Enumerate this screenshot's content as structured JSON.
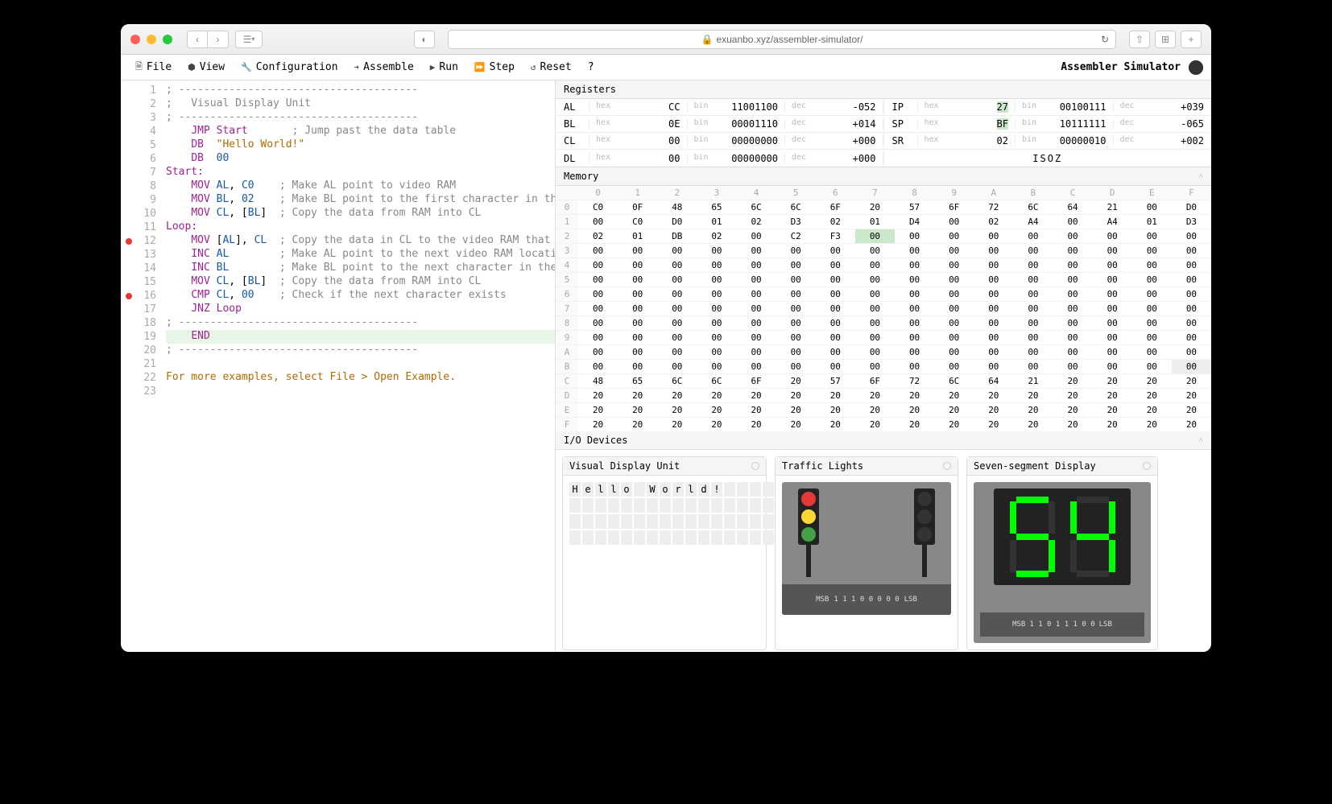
{
  "browser": {
    "url": "exuanbo.xyz/assembler-simulator/"
  },
  "toolbar": {
    "file": "File",
    "view": "View",
    "configuration": "Configuration",
    "assemble": "Assemble",
    "run": "Run",
    "step": "Step",
    "reset": "Reset",
    "help": "?",
    "title": "Assembler Simulator"
  },
  "editor": {
    "lines": [
      {
        "n": 1,
        "bp": false,
        "html": "<span class='c-comment'>; --------------------------------------</span>"
      },
      {
        "n": 2,
        "bp": false,
        "html": "<span class='c-comment'>;   Visual Display Unit</span>"
      },
      {
        "n": 3,
        "bp": false,
        "html": "<span class='c-comment'>; --------------------------------------</span>"
      },
      {
        "n": 4,
        "bp": false,
        "html": "    <span class='c-kw'>JMP</span> <span class='c-ident'>Start</span>       <span class='c-comment'>; Jump past the data table</span>"
      },
      {
        "n": 5,
        "bp": false,
        "html": "    <span class='c-kw'>DB</span>  <span class='c-str'>\"Hello World!\"</span>"
      },
      {
        "n": 6,
        "bp": false,
        "html": "    <span class='c-kw'>DB</span>  <span class='c-num'>00</span>"
      },
      {
        "n": 7,
        "bp": false,
        "html": "<span class='c-label'>Start:</span>"
      },
      {
        "n": 8,
        "bp": false,
        "html": "    <span class='c-kw'>MOV</span> <span class='c-reg'>AL</span>, <span class='c-num'>C0</span>    <span class='c-comment'>; Make AL point to video RAM</span>"
      },
      {
        "n": 9,
        "bp": false,
        "html": "    <span class='c-kw'>MOV</span> <span class='c-reg'>BL</span>, <span class='c-num'>02</span>    <span class='c-comment'>; Make BL point to the first character in the strin</span>"
      },
      {
        "n": 10,
        "bp": false,
        "html": "    <span class='c-kw'>MOV</span> <span class='c-reg'>CL</span>, [<span class='c-reg'>BL</span>]  <span class='c-comment'>; Copy the data from RAM into CL</span>"
      },
      {
        "n": 11,
        "bp": false,
        "html": "<span class='c-label'>Loop:</span>"
      },
      {
        "n": 12,
        "bp": true,
        "html": "    <span class='c-kw'>MOV</span> [<span class='c-reg'>AL</span>], <span class='c-reg'>CL</span>  <span class='c-comment'>; Copy the data in CL to the video RAM that AL poin</span>"
      },
      {
        "n": 13,
        "bp": false,
        "html": "    <span class='c-kw'>INC</span> <span class='c-reg'>AL</span>        <span class='c-comment'>; Make AL point to the next video RAM location</span>"
      },
      {
        "n": 14,
        "bp": false,
        "html": "    <span class='c-kw'>INC</span> <span class='c-reg'>BL</span>        <span class='c-comment'>; Make BL point to the next character in the string</span>"
      },
      {
        "n": 15,
        "bp": false,
        "html": "    <span class='c-kw'>MOV</span> <span class='c-reg'>CL</span>, [<span class='c-reg'>BL</span>]  <span class='c-comment'>; Copy the data from RAM into CL</span>"
      },
      {
        "n": 16,
        "bp": true,
        "html": "    <span class='c-kw'>CMP</span> <span class='c-reg'>CL</span>, <span class='c-num'>00</span>    <span class='c-comment'>; Check if the next character exists</span>"
      },
      {
        "n": 17,
        "bp": false,
        "html": "    <span class='c-kw'>JNZ</span> <span class='c-ident'>Loop</span>"
      },
      {
        "n": 18,
        "bp": false,
        "html": "<span class='c-comment'>; --------------------------------------</span>"
      },
      {
        "n": 19,
        "bp": false,
        "hl": true,
        "html": "    <span class='c-kw'>END</span>"
      },
      {
        "n": 20,
        "bp": false,
        "html": "<span class='c-comment'>; --------------------------------------</span>"
      },
      {
        "n": 21,
        "bp": false,
        "html": ""
      },
      {
        "n": 22,
        "bp": false,
        "html": "<span class='c-str'>For more examples, select File > Open Example.</span>"
      },
      {
        "n": 23,
        "bp": false,
        "html": ""
      }
    ]
  },
  "registers": {
    "header": "Registers",
    "left": [
      {
        "name": "AL",
        "hex": "CC",
        "bin": "11001100",
        "dec": "-052"
      },
      {
        "name": "BL",
        "hex": "0E",
        "bin": "00001110",
        "dec": "+014"
      },
      {
        "name": "CL",
        "hex": "00",
        "bin": "00000000",
        "dec": "+000"
      },
      {
        "name": "DL",
        "hex": "00",
        "bin": "00000000",
        "dec": "+000"
      }
    ],
    "right": [
      {
        "name": "IP",
        "hex": "27",
        "bin": "00100111",
        "dec": "+039",
        "hl": true
      },
      {
        "name": "SP",
        "hex": "BF",
        "bin": "10111111",
        "dec": "-065",
        "hl": true
      },
      {
        "name": "SR",
        "hex": "02",
        "bin": "00000010",
        "dec": "+002"
      }
    ],
    "flags": "ISOZ"
  },
  "memory": {
    "header": "Memory",
    "cols": [
      "0",
      "1",
      "2",
      "3",
      "4",
      "5",
      "6",
      "7",
      "8",
      "9",
      "A",
      "B",
      "C",
      "D",
      "E",
      "F"
    ],
    "rows": [
      {
        "h": "0",
        "cells": [
          "C0",
          "0F",
          "48",
          "65",
          "6C",
          "6C",
          "6F",
          "20",
          "57",
          "6F",
          "72",
          "6C",
          "64",
          "21",
          "00",
          "D0"
        ]
      },
      {
        "h": "1",
        "cells": [
          "00",
          "C0",
          "D0",
          "01",
          "02",
          "D3",
          "02",
          "01",
          "D4",
          "00",
          "02",
          "A4",
          "00",
          "A4",
          "01",
          "D3"
        ]
      },
      {
        "h": "2",
        "cells": [
          "02",
          "01",
          "DB",
          "02",
          "00",
          "C2",
          "F3",
          "00",
          "00",
          "00",
          "00",
          "00",
          "00",
          "00",
          "00",
          "00"
        ],
        "hl": {
          "7": "ip"
        }
      },
      {
        "h": "3",
        "cells": [
          "00",
          "00",
          "00",
          "00",
          "00",
          "00",
          "00",
          "00",
          "00",
          "00",
          "00",
          "00",
          "00",
          "00",
          "00",
          "00"
        ]
      },
      {
        "h": "4",
        "cells": [
          "00",
          "00",
          "00",
          "00",
          "00",
          "00",
          "00",
          "00",
          "00",
          "00",
          "00",
          "00",
          "00",
          "00",
          "00",
          "00"
        ]
      },
      {
        "h": "5",
        "cells": [
          "00",
          "00",
          "00",
          "00",
          "00",
          "00",
          "00",
          "00",
          "00",
          "00",
          "00",
          "00",
          "00",
          "00",
          "00",
          "00"
        ]
      },
      {
        "h": "6",
        "cells": [
          "00",
          "00",
          "00",
          "00",
          "00",
          "00",
          "00",
          "00",
          "00",
          "00",
          "00",
          "00",
          "00",
          "00",
          "00",
          "00"
        ]
      },
      {
        "h": "7",
        "cells": [
          "00",
          "00",
          "00",
          "00",
          "00",
          "00",
          "00",
          "00",
          "00",
          "00",
          "00",
          "00",
          "00",
          "00",
          "00",
          "00"
        ]
      },
      {
        "h": "8",
        "cells": [
          "00",
          "00",
          "00",
          "00",
          "00",
          "00",
          "00",
          "00",
          "00",
          "00",
          "00",
          "00",
          "00",
          "00",
          "00",
          "00"
        ]
      },
      {
        "h": "9",
        "cells": [
          "00",
          "00",
          "00",
          "00",
          "00",
          "00",
          "00",
          "00",
          "00",
          "00",
          "00",
          "00",
          "00",
          "00",
          "00",
          "00"
        ]
      },
      {
        "h": "A",
        "cells": [
          "00",
          "00",
          "00",
          "00",
          "00",
          "00",
          "00",
          "00",
          "00",
          "00",
          "00",
          "00",
          "00",
          "00",
          "00",
          "00"
        ]
      },
      {
        "h": "B",
        "cells": [
          "00",
          "00",
          "00",
          "00",
          "00",
          "00",
          "00",
          "00",
          "00",
          "00",
          "00",
          "00",
          "00",
          "00",
          "00",
          "00"
        ],
        "hl": {
          "15": "sp"
        }
      },
      {
        "h": "C",
        "cells": [
          "48",
          "65",
          "6C",
          "6C",
          "6F",
          "20",
          "57",
          "6F",
          "72",
          "6C",
          "64",
          "21",
          "20",
          "20",
          "20",
          "20"
        ]
      },
      {
        "h": "D",
        "cells": [
          "20",
          "20",
          "20",
          "20",
          "20",
          "20",
          "20",
          "20",
          "20",
          "20",
          "20",
          "20",
          "20",
          "20",
          "20",
          "20"
        ]
      },
      {
        "h": "E",
        "cells": [
          "20",
          "20",
          "20",
          "20",
          "20",
          "20",
          "20",
          "20",
          "20",
          "20",
          "20",
          "20",
          "20",
          "20",
          "20",
          "20"
        ]
      },
      {
        "h": "F",
        "cells": [
          "20",
          "20",
          "20",
          "20",
          "20",
          "20",
          "20",
          "20",
          "20",
          "20",
          "20",
          "20",
          "20",
          "20",
          "20",
          "20"
        ]
      }
    ]
  },
  "devices": {
    "header": "I/O Devices",
    "vdu": {
      "title": "Visual Display Unit",
      "chars": [
        "H",
        "e",
        "l",
        "l",
        "o",
        " ",
        "W",
        "o",
        "r",
        "l",
        "d",
        "!",
        " ",
        " ",
        " ",
        " "
      ]
    },
    "traffic": {
      "title": "Traffic Lights",
      "bits": [
        "1",
        "1",
        "1",
        "0",
        "0",
        "0",
        "0",
        "0"
      ],
      "msb": "MSB",
      "lsb": "LSB",
      "left": {
        "red": true,
        "yellow": true,
        "green": true
      },
      "right": {
        "red": false,
        "yellow": false,
        "green": false
      }
    },
    "seven": {
      "title": "Seven-segment Display",
      "msb": "MSB",
      "lsb": "LSB",
      "bits": [
        "1",
        "1",
        "0",
        "1",
        "1",
        "1",
        "0",
        "0"
      ],
      "digits": [
        {
          "a": true,
          "b": false,
          "c": true,
          "d": true,
          "e": false,
          "f": true,
          "g": true
        },
        {
          "a": false,
          "b": true,
          "c": true,
          "d": false,
          "e": false,
          "f": true,
          "g": true
        }
      ]
    }
  }
}
